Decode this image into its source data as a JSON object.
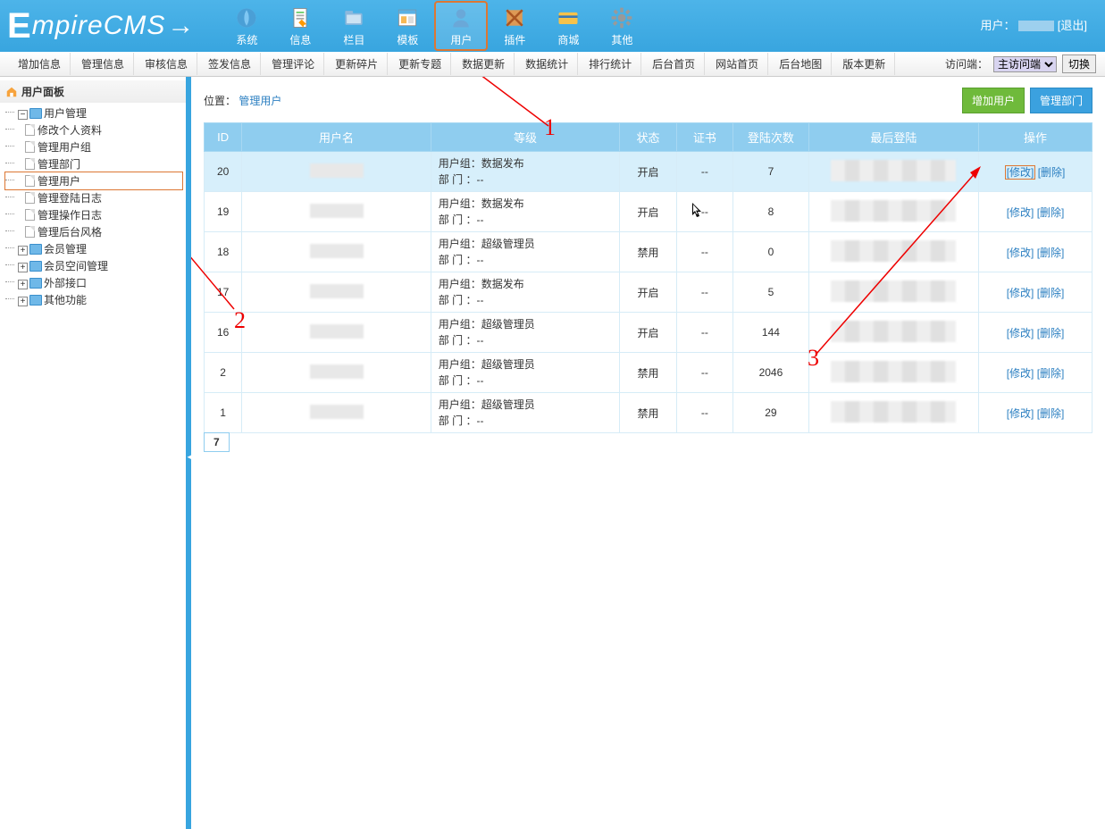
{
  "logo": "mpireCMS",
  "user_label": "用户：",
  "logout": "[退出]",
  "nav": [
    {
      "label": "系统",
      "icon": "globe"
    },
    {
      "label": "信息",
      "icon": "doc"
    },
    {
      "label": "栏目",
      "icon": "folder"
    },
    {
      "label": "模板",
      "icon": "window"
    },
    {
      "label": "用户",
      "icon": "user",
      "selected": true
    },
    {
      "label": "插件",
      "icon": "puzzle"
    },
    {
      "label": "商城",
      "icon": "card"
    },
    {
      "label": "其他",
      "icon": "gear"
    }
  ],
  "subnav": [
    "增加信息",
    "管理信息",
    "审核信息",
    "签发信息",
    "管理评论",
    "更新碎片",
    "更新专题",
    "数据更新",
    "数据统计",
    "排行统计",
    "后台首页",
    "网站首页",
    "后台地图",
    "版本更新"
  ],
  "visit_label": "访问端：",
  "visit_select": "主访问端",
  "switch_btn": "切换",
  "side_title": "用户面板",
  "tree": {
    "root": "用户管理",
    "children": [
      "修改个人资料",
      "管理用户组",
      "管理部门",
      "管理用户",
      "管理登陆日志",
      "管理操作日志",
      "管理后台风格"
    ],
    "others": [
      "会员管理",
      "会员空间管理",
      "外部接口",
      "其他功能"
    ],
    "selected_index": 3
  },
  "breadcrumb": {
    "pos": "位置：",
    "page": "管理用户"
  },
  "btns": {
    "add": "增加用户",
    "dept": "管理部门"
  },
  "table": {
    "headers": [
      "ID",
      "用户名",
      "等级",
      "状态",
      "证书",
      "登陆次数",
      "最后登陆",
      "操作"
    ],
    "rows": [
      {
        "id": "20",
        "group": "数据发布",
        "status": "开启",
        "cert": "--",
        "logins": "7",
        "hi": true
      },
      {
        "id": "19",
        "group": "数据发布",
        "status": "开启",
        "cert": "--",
        "logins": "8"
      },
      {
        "id": "18",
        "group": "超级管理员",
        "status": "禁用",
        "cert": "--",
        "logins": "0"
      },
      {
        "id": "17",
        "group": "数据发布",
        "status": "开启",
        "cert": "--",
        "logins": "5"
      },
      {
        "id": "16",
        "group": "超级管理员",
        "status": "开启",
        "cert": "--",
        "logins": "144"
      },
      {
        "id": "2",
        "group": "超级管理员",
        "status": "禁用",
        "cert": "--",
        "logins": "2046"
      },
      {
        "id": "1",
        "group": "超级管理员",
        "status": "禁用",
        "cert": "--",
        "logins": "29"
      }
    ],
    "group_label": "用户组：",
    "dept_label": "部  门  ：--",
    "edit": "[修改]",
    "del": "[删除]"
  },
  "pager": "7",
  "anno": {
    "n1": "1",
    "n2": "2",
    "n3": "3"
  }
}
